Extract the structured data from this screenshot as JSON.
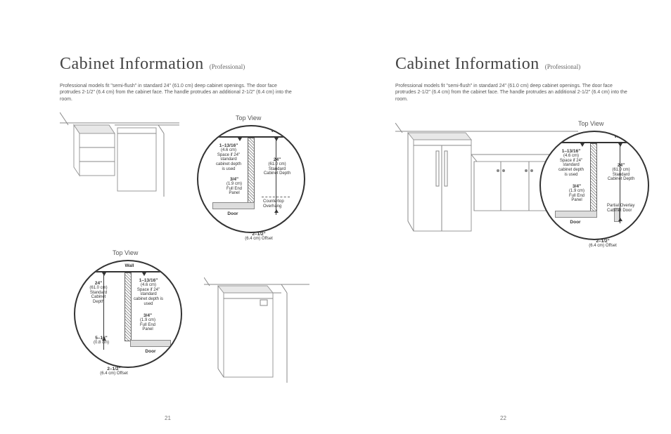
{
  "left": {
    "title": "Cabinet Information",
    "sub": "(Professional)",
    "body": "Professional models fit \"semi-flush\" in standard 24\" (61.0 cm) deep cabinet openings. The door face protrudes 2-1/2\" (6.4 cm) from the cabinet face. The handle protrudes an additional 2-1/2\" (6.4 cm) into the room.",
    "top_view_label_upper": "Top View",
    "top_view_label_lower": "Top View",
    "detail1": {
      "wall": "Wall",
      "spacer_dim": "1–13/16\"",
      "spacer_cm": "(4.6 cm)",
      "spacer_txt": "Space if 24\" standard cabinet depth is used",
      "depth_dim": "24\"",
      "depth_cm": "(61.0 cm)",
      "depth_txt": "Standard Cabinet Depth",
      "panel_dim": "3/4\"",
      "panel_cm": "(1.9 cm)",
      "panel_txt": "Full End Panel",
      "overhang": "Countertop Overhang",
      "door": "Door",
      "offset_dim": "2–1/2\"",
      "offset_txt": "(6.4 cm) Offset"
    },
    "detail2": {
      "wall": "Wall",
      "depth_dim": "24\"",
      "depth_cm": "(61.0 cm)",
      "depth_txt": "Standard Cabinet Depth",
      "spacer_dim": "1–13/16\"",
      "spacer_cm": "(4.6 cm)",
      "spacer_txt": "Space if 24\" standard cabinet depth is used",
      "panel_dim": "3/4\"",
      "panel_cm": "(1.9 cm)",
      "panel_txt": "Full End Panel",
      "gap_dim": "5–16\"",
      "gap_cm": "(0.8 cm)",
      "door": "Door",
      "offset_dim": "2–1/2\"",
      "offset_txt": "(6.4 cm) Offset"
    },
    "page_num": "21"
  },
  "right": {
    "title": "Cabinet Information",
    "sub": "(Professional)",
    "body": "Professional models fit \"semi-flush\" in standard 24\" (61.0 cm) deep cabinet openings. The door face protrudes 2-1/2\" (6.4 cm) from the cabinet face. The handle protrudes an additional 2-1/2\" (6.4 cm) into the room.",
    "top_view_label": "Top View",
    "detail1": {
      "wall": "Wall",
      "spacer_dim": "1–13/16\"",
      "spacer_cm": "(4.6 cm)",
      "spacer_txt": "Space if 24\" standard cabinet depth is used",
      "depth_dim": "24\"",
      "depth_cm": "(61.0 cm)",
      "depth_txt": "Standard Cabinet Depth",
      "panel_dim": "3/4\"",
      "panel_cm": "(1.9 cm)",
      "panel_txt": "Full End Panel",
      "overlay": "Partial Overlay Cabinet Door",
      "door": "Door",
      "offset_dim": "2–1/2\"",
      "offset_txt": "(6.4 cm) Offset"
    },
    "page_num": "22"
  }
}
